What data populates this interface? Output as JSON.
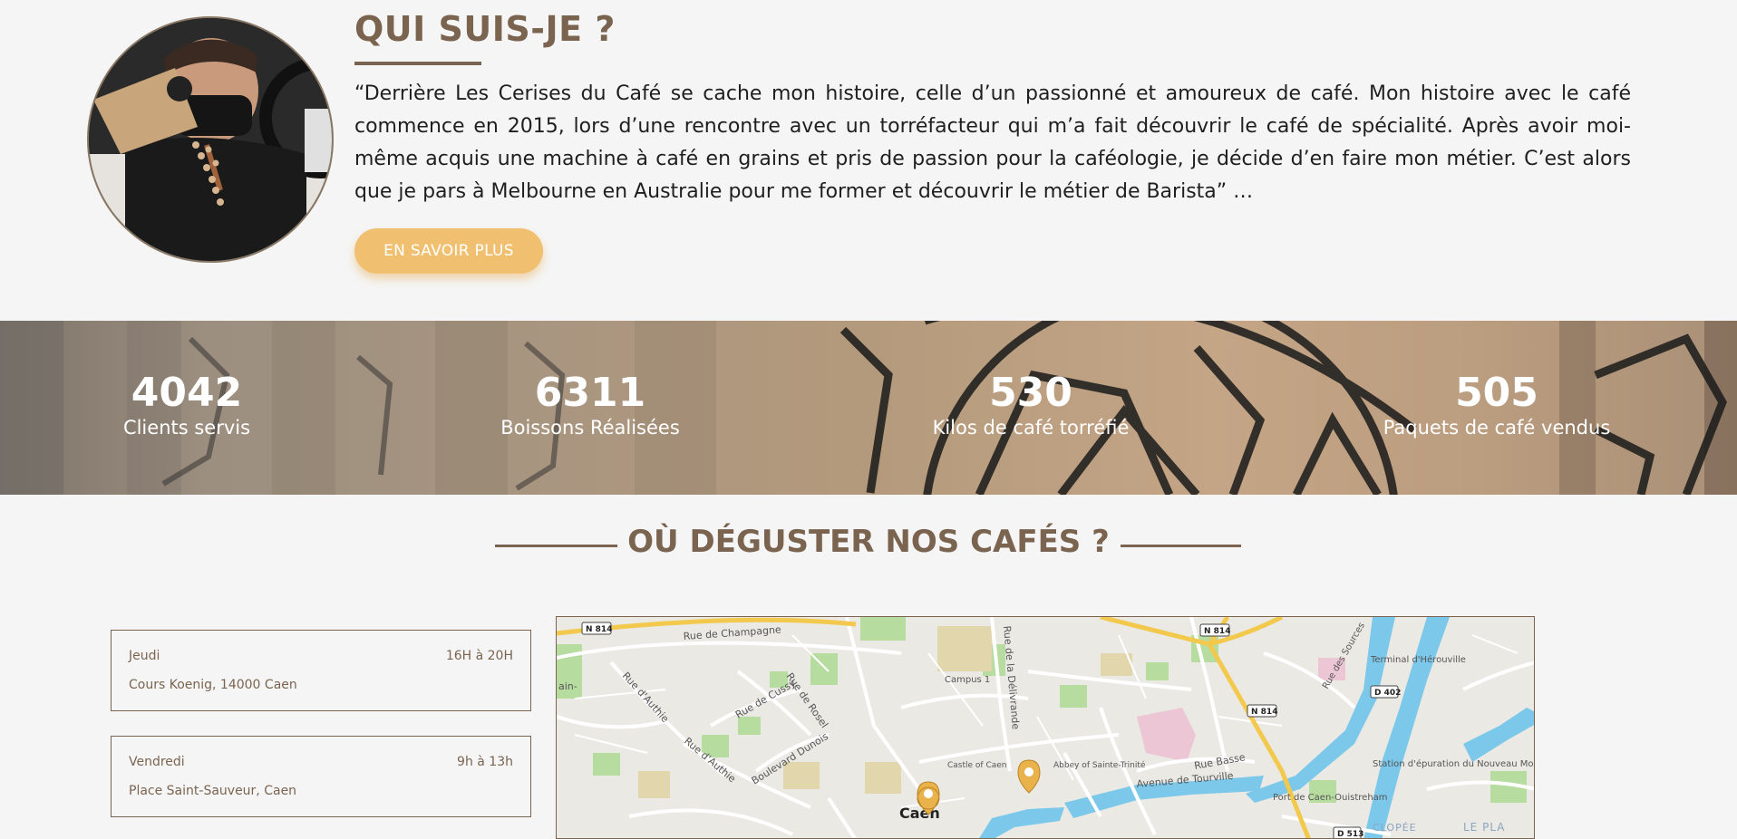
{
  "about": {
    "title": "QUI SUIS-JE ?",
    "text": "“Derrière Les Cerises du Café se cache mon histoire, celle d’un passionné et amoureux de café. Mon histoire avec le café commence en 2015, lors d’une rencontre avec un torréfacteur qui m’a fait découvrir le café de spécialité. Après avoir moi-même acquis une machine à café en grains et pris de passion pour la caféologie, je décide d’en faire mon métier. C’est alors que je pars à Melbourne en Australie pour me former et découvrir le métier de Barista” …",
    "cta_label": "EN SAVOIR PLUS"
  },
  "stats": [
    {
      "value": "4042",
      "label": "Clients servis"
    },
    {
      "value": "6311",
      "label": "Boissons Réalisées"
    },
    {
      "value": "530",
      "label": "Kilos de café torréfié"
    },
    {
      "value": "505",
      "label": "Paquets de café vendus"
    }
  ],
  "where": {
    "title": "OÙ DÉGUSTER NOS CAFÉS ?",
    "locations": [
      {
        "day": "Jeudi",
        "hours": "16H à 20H",
        "place": "Cours Koenig, 14000 Caen"
      },
      {
        "day": "Vendredi",
        "hours": "9h à 13h",
        "place": "Place Saint-Sauveur, Caen"
      }
    ]
  },
  "map": {
    "labels": {
      "n814_a": "N 814",
      "n814_b": "N 814",
      "n814_c": "N 814",
      "rue_champagne": "Rue de Champagne",
      "rue_authie": "Rue d'Authie",
      "rue_authie_2": "Rue d'Authie",
      "rue_cussy": "Rue de Cussy",
      "rue_rosel": "Rue de Rosel",
      "boulevard_dunois": "Boulevard Dunois",
      "rue_delivrande": "Rue de la Délivrande",
      "campus": "Campus 1",
      "castle": "Castle of Caen",
      "abbey": "Abbey of Sainte-Trinité",
      "avenue_tourville": "Avenue de Tourville",
      "rue_basse": "Rue Basse",
      "caen": "Caen",
      "port": "Port de Caen-Ouistreham",
      "terminal": "Terminal d'Hérouville",
      "d402": "D 402",
      "rue_sources": "Rue des Sources",
      "station": "Station d'épuration du Nouveau Monde",
      "d513": "D 513",
      "clopee": "CLOPÉE",
      "le_pla": "LE PLA",
      "ain": "ain-"
    },
    "colors": {
      "water": "#7cc8ea",
      "park": "#a8d58a",
      "major_road": "#f2c94c",
      "pin": "#e9b24a"
    }
  }
}
